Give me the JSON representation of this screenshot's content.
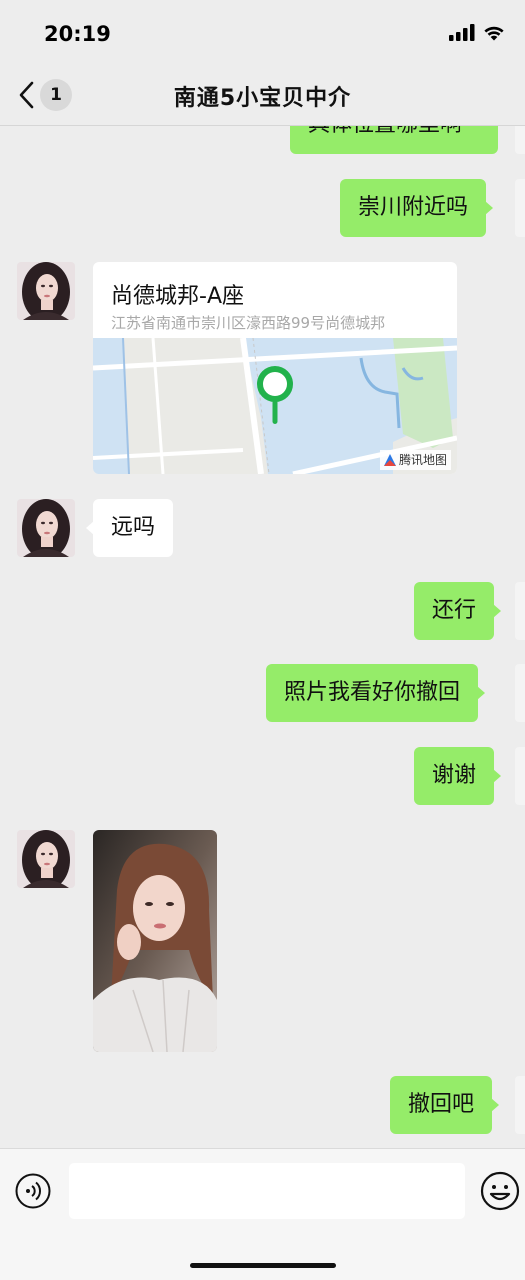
{
  "status_bar": {
    "time": "20:19"
  },
  "nav": {
    "back_count": "1",
    "title": "南通5小宝贝中介"
  },
  "messages": [
    {
      "direction": "outgoing",
      "type": "text",
      "text": "具体位置哪里啊",
      "partial": true
    },
    {
      "direction": "outgoing",
      "type": "text",
      "text": "崇川附近吗"
    },
    {
      "direction": "incoming",
      "type": "location",
      "place_name": "尚德城邦-A座",
      "address": "江苏省南通市崇川区濠西路99号尚德城邦",
      "map_provider": "腾讯地图",
      "icon": "map-pin-icon"
    },
    {
      "direction": "incoming",
      "type": "text",
      "text": "远吗"
    },
    {
      "direction": "outgoing",
      "type": "text",
      "text": "还行"
    },
    {
      "direction": "outgoing",
      "type": "text",
      "text": "照片我看好你撤回"
    },
    {
      "direction": "outgoing",
      "type": "text",
      "text": "谢谢"
    },
    {
      "direction": "incoming",
      "type": "image"
    },
    {
      "direction": "outgoing",
      "type": "text",
      "text": "撤回吧"
    }
  ],
  "input_bar": {
    "placeholder": "",
    "voice_icon": "voice-icon",
    "emoji_icon": "emoji-icon"
  },
  "colors": {
    "background": "#ededed",
    "outgoing_bubble": "#95ec69",
    "incoming_bubble": "#ffffff",
    "location_pin": "#22b24c"
  }
}
